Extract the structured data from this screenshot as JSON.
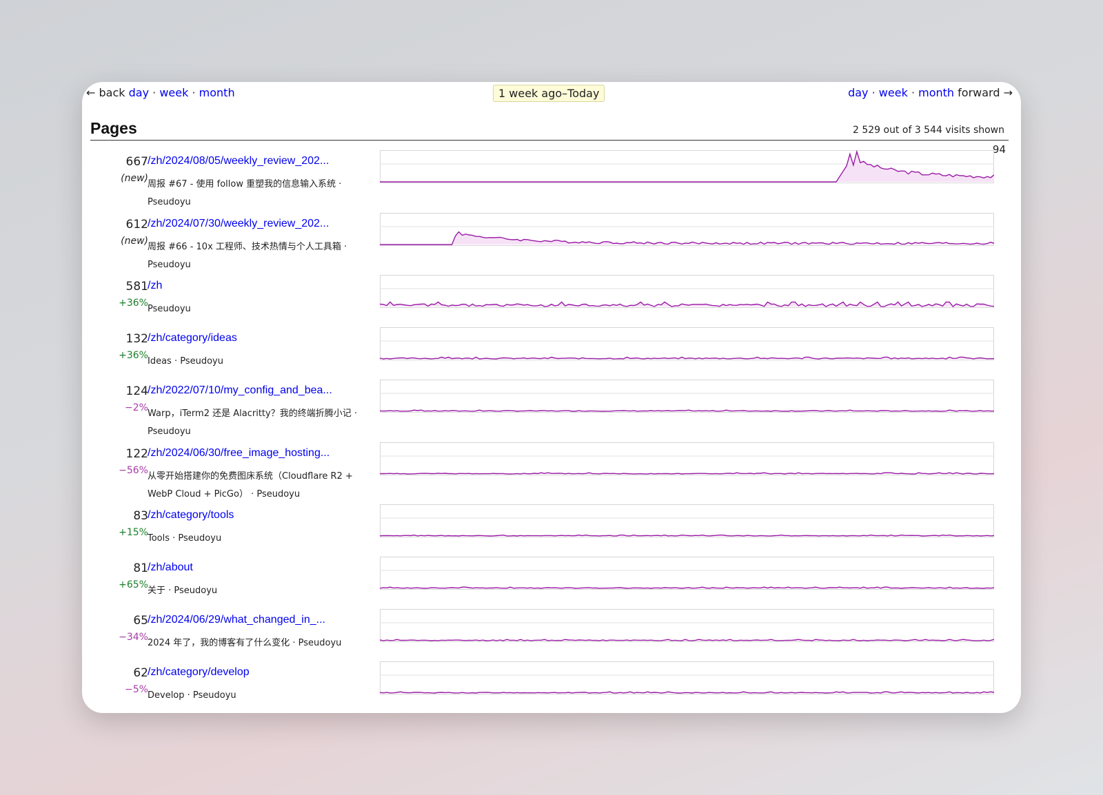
{
  "nav": {
    "left_back": "← back",
    "left_day": "day",
    "left_week": "week",
    "left_month": "month",
    "period": "1 week ago–Today",
    "right_day": "day",
    "right_week": "week",
    "right_month": "month",
    "right_forward": "forward →",
    "sep": "·"
  },
  "section": {
    "title": "Pages",
    "visits_shown": "2 529 out of 3 544 visits shown",
    "max_value": "94"
  },
  "colors": {
    "line": "#9a1aa6",
    "fill": "#f6e2f6",
    "link": "#0000ee",
    "positive": "#1a7f2a",
    "negative": "#a83aa8"
  },
  "pages": [
    {
      "count": "667",
      "change": "(new)",
      "change_kind": "new",
      "path": "/zh/2024/08/05/weekly_review_202...",
      "description": "周报 #67 - 使用 follow 重塑我的信息输入系统 · Pseudoyu",
      "spark_peak": 1.0,
      "spark_shape": "late"
    },
    {
      "count": "612",
      "change": "(new)",
      "change_kind": "new",
      "path": "/zh/2024/07/30/weekly_review_202...",
      "description": "周报 #66 - 10x 工程师、技术热情与个人工具箱 · Pseudoyu",
      "spark_peak": 0.4,
      "spark_shape": "early"
    },
    {
      "count": "581",
      "change": "+36%",
      "change_kind": "pos",
      "path": "/zh",
      "description": "Pseudoyu",
      "spark_peak": 0.15,
      "spark_shape": "flat"
    },
    {
      "count": "132",
      "change": "+36%",
      "change_kind": "pos",
      "path": "/zh/category/ideas",
      "description": "Ideas · Pseudoyu",
      "spark_peak": 0.06,
      "spark_shape": "flat"
    },
    {
      "count": "124",
      "change": "−2%",
      "change_kind": "neg",
      "path": "/zh/2022/07/10/my_config_and_bea...",
      "description": "Warp，iTerm2 还是 Alacritty？我的终端折腾小记 · Pseudoyu",
      "spark_peak": 0.04,
      "spark_shape": "flat"
    },
    {
      "count": "122",
      "change": "−56%",
      "change_kind": "neg",
      "path": "/zh/2024/06/30/free_image_hosting...",
      "description": "从零开始搭建你的免费图床系统（Cloudflare R2 + WebP Cloud + PicGo） · Pseudoyu",
      "spark_peak": 0.04,
      "spark_shape": "flat"
    },
    {
      "count": "83",
      "change": "+15%",
      "change_kind": "pos",
      "path": "/zh/category/tools",
      "description": "Tools · Pseudoyu",
      "spark_peak": 0.03,
      "spark_shape": "flat"
    },
    {
      "count": "81",
      "change": "+65%",
      "change_kind": "pos",
      "path": "/zh/about",
      "description": "关于 · Pseudoyu",
      "spark_peak": 0.04,
      "spark_shape": "flat"
    },
    {
      "count": "65",
      "change": "−34%",
      "change_kind": "neg",
      "path": "/zh/2024/06/29/what_changed_in_...",
      "description": "2024 年了，我的博客有了什么变化 · Pseudoyu",
      "spark_peak": 0.04,
      "spark_shape": "flat"
    },
    {
      "count": "62",
      "change": "−5%",
      "change_kind": "neg",
      "path": "/zh/category/develop",
      "description": "Develop · Pseudoyu",
      "spark_peak": 0.04,
      "spark_shape": "flat"
    }
  ]
}
